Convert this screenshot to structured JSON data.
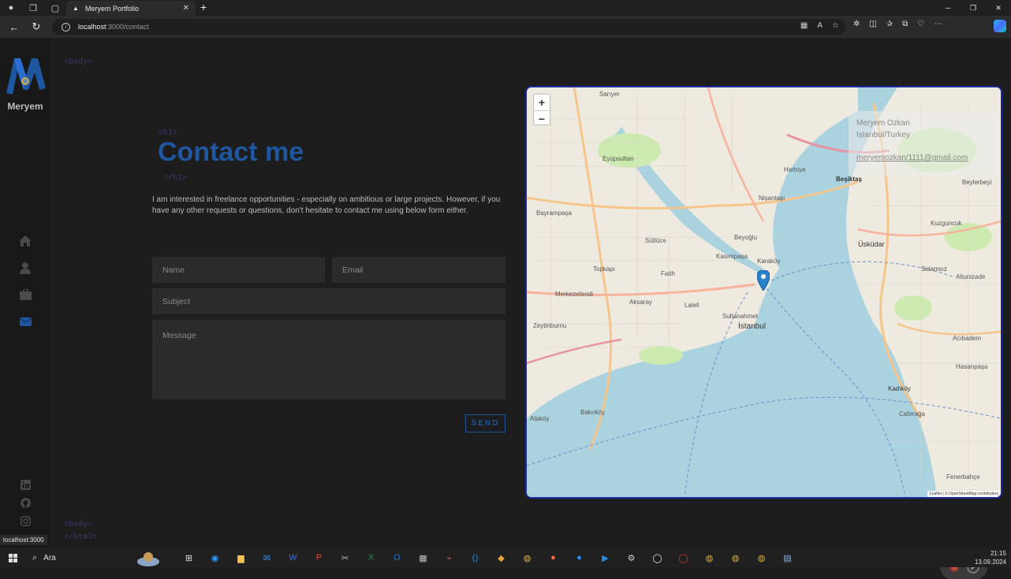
{
  "browser": {
    "tab_title": "Meryem Portfolio",
    "url_host": "localhost",
    "url_path": ":3000/contact",
    "status_url": "localhost:3000"
  },
  "sidebar": {
    "logo_letter": "M",
    "name": "Meryem",
    "accent": "#1e56a0"
  },
  "tags": {
    "body_open": "<body>",
    "h1_open": "<h1>",
    "h1_close": "</h1>",
    "body_close": "<body>",
    "html_close": "</html>"
  },
  "contact": {
    "title": "Contact me",
    "intro": "I am interested in freelance opportunities - especially on ambitious or large projects. However, if you have any other requests or questions, don't hesitate to contact me using below form either.",
    "name_placeholder": "Name",
    "email_placeholder": "Email",
    "subject_placeholder": "Subject",
    "message_placeholder": "Message",
    "send_label": "SEND"
  },
  "map": {
    "zoom_in": "+",
    "zoom_out": "−",
    "info_name": "Meryem Ozkan",
    "info_city": "Istanbul/Turkey",
    "info_email": "meryemozkan/1111@gmail.com",
    "attribution": "Leaflet | © OpenStreetMap contributors",
    "labels": [
      "Sarıyer",
      "Sütlüce",
      "Eyüpsultan",
      "Beşiktaş",
      "Beyoğlu",
      "Fatih",
      "İstanbul",
      "Üsküdar",
      "Kadıköy",
      "Bayrampaşa",
      "Zeytinburnu",
      "Ataköy",
      "Bakırköy",
      "Merkezefendi",
      "Kuzguncuk",
      "Beylerbeyi",
      "Altunizade",
      "Acıbadem",
      "Hasanpaşa",
      "Fenerbahçe",
      "Caferağa",
      "Selamsız",
      "Harbiye",
      "Nişantaşı",
      "Kasımpaşa",
      "Karaköy",
      "Sultanahmet",
      "Topkapı",
      "Aksaray",
      "Laleli"
    ]
  },
  "taskbar": {
    "search_label": "Ara",
    "time": "21:15",
    "date": "13.09.2024"
  }
}
